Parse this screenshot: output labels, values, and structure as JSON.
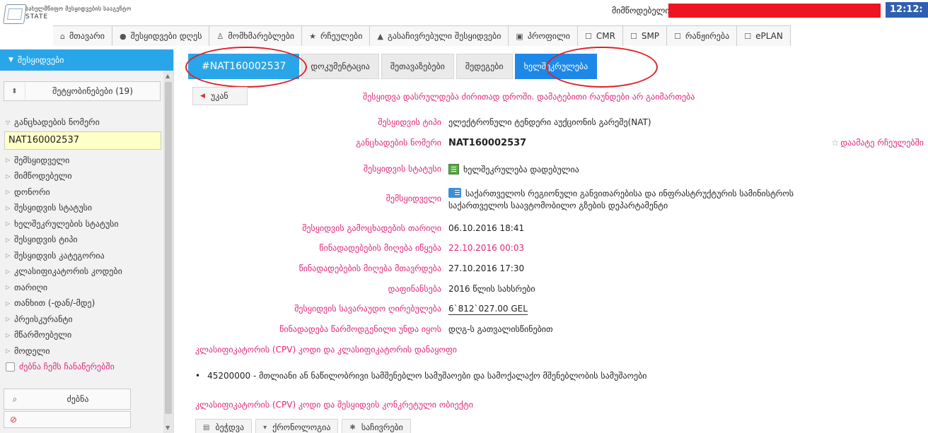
{
  "header": {
    "logo_name": "სახელმწიფო შესყიდვების სააგენტო",
    "logo_sub": "STATE",
    "supplier_label": "მიმწოდებელი:",
    "clock": "12:12:",
    "redacted_color": "#ef1421"
  },
  "topnav": [
    {
      "icon": "home-icon",
      "glyph": "⌂",
      "label": "მთავარი"
    },
    {
      "icon": "clock-icon",
      "glyph": "●",
      "label": "შესყიდვები დღეს"
    },
    {
      "icon": "user-icon",
      "glyph": "♙",
      "label": "მომხმარებლები"
    },
    {
      "icon": "star-icon",
      "glyph": "★",
      "label": "რჩეულები"
    },
    {
      "icon": "warning-icon",
      "glyph": "▲",
      "label": "გასაჩივრებული შესყიდვები"
    },
    {
      "icon": "profile-icon",
      "glyph": "▣",
      "label": "პროფილი"
    },
    {
      "icon": "cmr-icon",
      "glyph": "☐",
      "label": "CMR"
    },
    {
      "icon": "smp-icon",
      "glyph": "☐",
      "label": "SMP"
    },
    {
      "icon": "rank-icon",
      "glyph": "☐",
      "label": "რანჟირება"
    },
    {
      "icon": "eplan-icon",
      "glyph": "☐",
      "label": "ePLAN"
    }
  ],
  "sidebar": {
    "title": "შესყიდვები",
    "notifications": "შეტყობინებები (19)",
    "filters": [
      "განცხადების ნომერი",
      "შემსყიდველი",
      "მიმწოდებელი",
      "დონორი",
      "შესყიდვის სტატუსი",
      "ხელშეკრულების სტატუსი",
      "შესყიდვის ტიპი",
      "შესყიდვის კატეგორია",
      "კლასიფიკატორის კოდები",
      "თარიღი",
      "თანხით (-დან/-მდე)",
      "პრეისკურანტი",
      "მწარმოებელი",
      "მოდელი"
    ],
    "notice_number_value": "NAT160002537",
    "search_in_records": "ძებნა ჩემს ჩანაწერებში",
    "search_button": "ძებნა",
    "search_input_color": "#ffffc8"
  },
  "tabs": [
    {
      "label": "#NAT160002537",
      "state": "active"
    },
    {
      "label": "დოკუმენტაცია",
      "state": ""
    },
    {
      "label": "შეთავაზებები",
      "state": ""
    },
    {
      "label": "შედეგები",
      "state": ""
    },
    {
      "label": "ხელშეკრულება",
      "state": "blue"
    }
  ],
  "back_button": "უკან",
  "notice": "შესყიდვა დასრულდება ძირითად დროში. დამატებითი რაუნდები არ გაიმართება",
  "details": {
    "type_label": "შესყიდვის ტიპი",
    "type_value": "ელექტრონული ტენდერი აუქციონის გარეშე(NAT)",
    "number_label": "განცხადების ნომერი",
    "number_value": "NAT160002537",
    "favorite_link": "დაამატე რჩეულებში",
    "status_label": "შესყიდვის სტატუსი",
    "status_value": "ხელშეკრულება დადებულია",
    "buyer_label": "შემსყიდველი",
    "buyer_line1": "საქართველოს რეგიონული განვითარებისა და ინფრასტრუქტურის სამინისტროს",
    "buyer_line2": "საქართველოს საავტომობილო გზების დეპარტამენტი",
    "announce_label": "შესყიდვის გამოცხადების თარიღი",
    "announce_value": "06.10.2016 18:41",
    "offers_start_label": "წინადადებების მიღება იწყება",
    "offers_start_value": "22.10.2016 00:03",
    "offers_end_label": "წინადადებების მიღება მთავრდება",
    "offers_end_value": "27.10.2016 17:30",
    "funding_label": "დაფინანსება",
    "funding_value": "2016 წლის სახსრები",
    "estimated_label": "შესყიდვის სავარაუდო ღირებულება",
    "estimated_value": "6`812`027.00 GEL",
    "offer_label": "წინადადება წარმოდგენილი უნდა იყოს",
    "offer_value": "დღგ-ს გათვალისწინებით"
  },
  "cpv_section_link": "კლასიფიკატორის (CPV) კოდი და კლასიფიკატორის დანაყოფი",
  "cpv_item": "45200000 - მთლიანი ან ნაწილობრივი სამშენებლო სამუშაოები და სამოქალაქო მშენებლობის სამუშაოები",
  "cpv_object_link": "კლასიფიკატორის (CPV) კოდი და შესყიდვის კონკრეტული ობიექტი",
  "bottom_buttons": [
    {
      "icon": "print-icon",
      "glyph": "▤",
      "label": "ბეჭდვა"
    },
    {
      "icon": "chronology-icon",
      "glyph": "▾",
      "label": "ქრონოლოგია"
    },
    {
      "icon": "complaint-icon",
      "glyph": "✱",
      "label": "საჩივრები"
    }
  ],
  "accent_color": "#29a6e9",
  "highlight_color": "#e0267a"
}
